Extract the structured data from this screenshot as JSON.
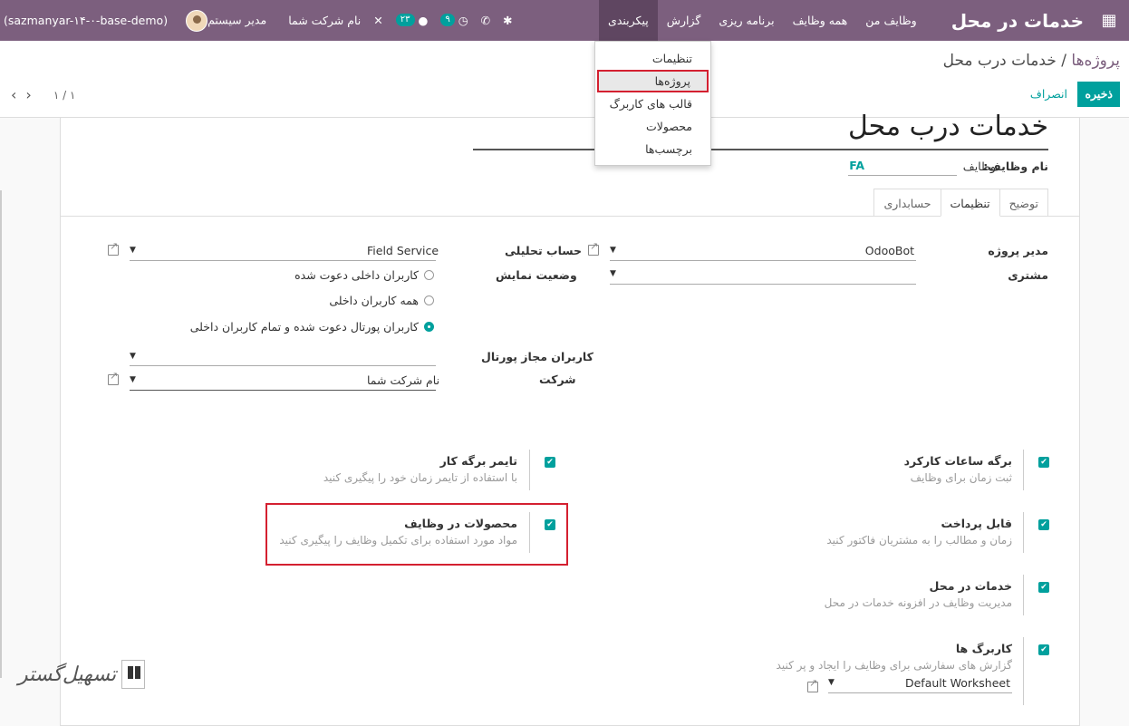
{
  "navbar": {
    "brand": "خدمات در محل",
    "menu": [
      "وظایف من",
      "همه وظایف",
      "برنامه ریزی",
      "گزارش",
      "پیکربندی"
    ],
    "company": "نام شرکت شما",
    "user": "مدیر سیستم",
    "db": "(sazmanyar-۱۴-۰-base-demo)",
    "badge_activities": "۹",
    "badge_messages": "۲۳"
  },
  "dropdown": [
    "تنظیمات",
    "پروژه‌ها",
    "قالب های کاربرگ",
    "محصولات",
    "برچسب‌ها"
  ],
  "control": {
    "breadcrumb_parent": "پروژه‌ها",
    "breadcrumb_sep": "/",
    "breadcrumb_current": "خدمات درب محل",
    "save": "ذخیره",
    "discard": "انصراف",
    "pager": "۱ / ۱"
  },
  "form": {
    "title": "خدمات درب محل",
    "tasks_label": "نام وظایف:",
    "tasks_value": "وظایف",
    "lang": "FA",
    "tabs": [
      "توضیح",
      "تنظیمات",
      "حسابداری"
    ],
    "manager_label": "مدیر پروژه",
    "manager_value": "OdooBot",
    "customer_label": "مشتری",
    "account_label": "حساب تحلیلی",
    "account_value": "Field Service",
    "visibility_label": "وضعیت نمایش",
    "visibility_options": [
      "کاربران داخلی دعوت شده",
      "همه کاربران داخلی",
      "کاربران پورتال دعوت شده و تمام کاربران داخلی"
    ],
    "portal_label": "کاربران مجاز پورتال",
    "company_label": "شرکت",
    "company_value": "نام شرکت شما"
  },
  "options": {
    "timesheet": {
      "title": "برگه ساعات کارکرد",
      "desc": "ثبت زمان برای وظایف"
    },
    "timer": {
      "title": "تایمر برگه کار",
      "desc": "با استفاده از تایمر زمان خود را پیگیری کنید"
    },
    "billable": {
      "title": "قابل پرداخت",
      "desc": "زمان و مطالب را به مشتریان فاکتور کنید"
    },
    "products": {
      "title": "محصولات در وظایف",
      "desc": "مواد مورد استفاده برای تکمیل وظایف را پیگیری کنید"
    },
    "fsm": {
      "title": "خدمات در محل",
      "desc": "مدیریت وظایف در افزونه خدمات در محل"
    },
    "worksheet": {
      "title": "کاربرگ ها",
      "desc": "گزارش های سفارشی برای وظایف را ایجاد و پر کنید",
      "value": "Default Worksheet"
    }
  },
  "watermark": "تسهیل‌گستر"
}
